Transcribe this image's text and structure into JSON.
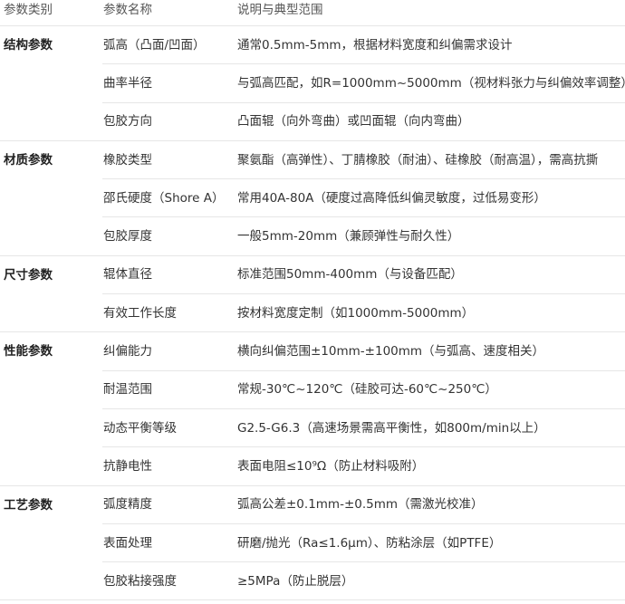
{
  "headers": [
    "参数类别",
    "参数名称",
    "说明与典型范围"
  ],
  "groups": [
    {
      "category": "结构参数",
      "rows": [
        {
          "name": "弧高（凸面/凹面）",
          "desc": "通常0.5mm-5mm，根据材料宽度和纠偏需求设计"
        },
        {
          "name": "曲率半径",
          "desc": "与弧高匹配，如R=1000mm~5000mm（视材料张力与纠偏效率调整）"
        },
        {
          "name": "包胶方向",
          "desc": "凸面辊（向外弯曲）或凹面辊（向内弯曲）"
        }
      ]
    },
    {
      "category": "材质参数",
      "rows": [
        {
          "name": "橡胶类型",
          "desc": "聚氨酯（高弹性）、丁腈橡胶（耐油）、硅橡胶（耐高温），需高抗撕"
        },
        {
          "name": "邵氏硬度（Shore A）",
          "desc": "常用40A-80A（硬度过高降低纠偏灵敏度，过低易变形）"
        },
        {
          "name": "包胶厚度",
          "desc": "一般5mm-20mm（兼顾弹性与耐久性）"
        }
      ]
    },
    {
      "category": "尺寸参数",
      "rows": [
        {
          "name": "辊体直径",
          "desc": "标准范围50mm-400mm（与设备匹配）"
        },
        {
          "name": "有效工作长度",
          "desc": "按材料宽度定制（如1000mm-5000mm）"
        }
      ]
    },
    {
      "category": "性能参数",
      "rows": [
        {
          "name": "纠偏能力",
          "desc": "横向纠偏范围±10mm-±100mm（与弧高、速度相关）"
        },
        {
          "name": "耐温范围",
          "desc": "常规-30℃~120℃（硅胶可达-60℃~250℃）"
        },
        {
          "name": "动态平衡等级",
          "desc": "G2.5-G6.3（高速场景需高平衡性，如800m/min以上）"
        },
        {
          "name": "抗静电性",
          "desc": "表面电阻≤10⁹Ω（防止材料吸附）"
        }
      ]
    },
    {
      "category": "工艺参数",
      "rows": [
        {
          "name": "弧度精度",
          "desc": "弧高公差±0.1mm-±0.5mm（需激光校准）"
        },
        {
          "name": "表面处理",
          "desc": "研磨/抛光（Ra≤1.6μm）、防粘涂层（如PTFE）"
        },
        {
          "name": "包胶粘接强度",
          "desc": "≥5MPa（防止脱层）"
        }
      ]
    }
  ]
}
